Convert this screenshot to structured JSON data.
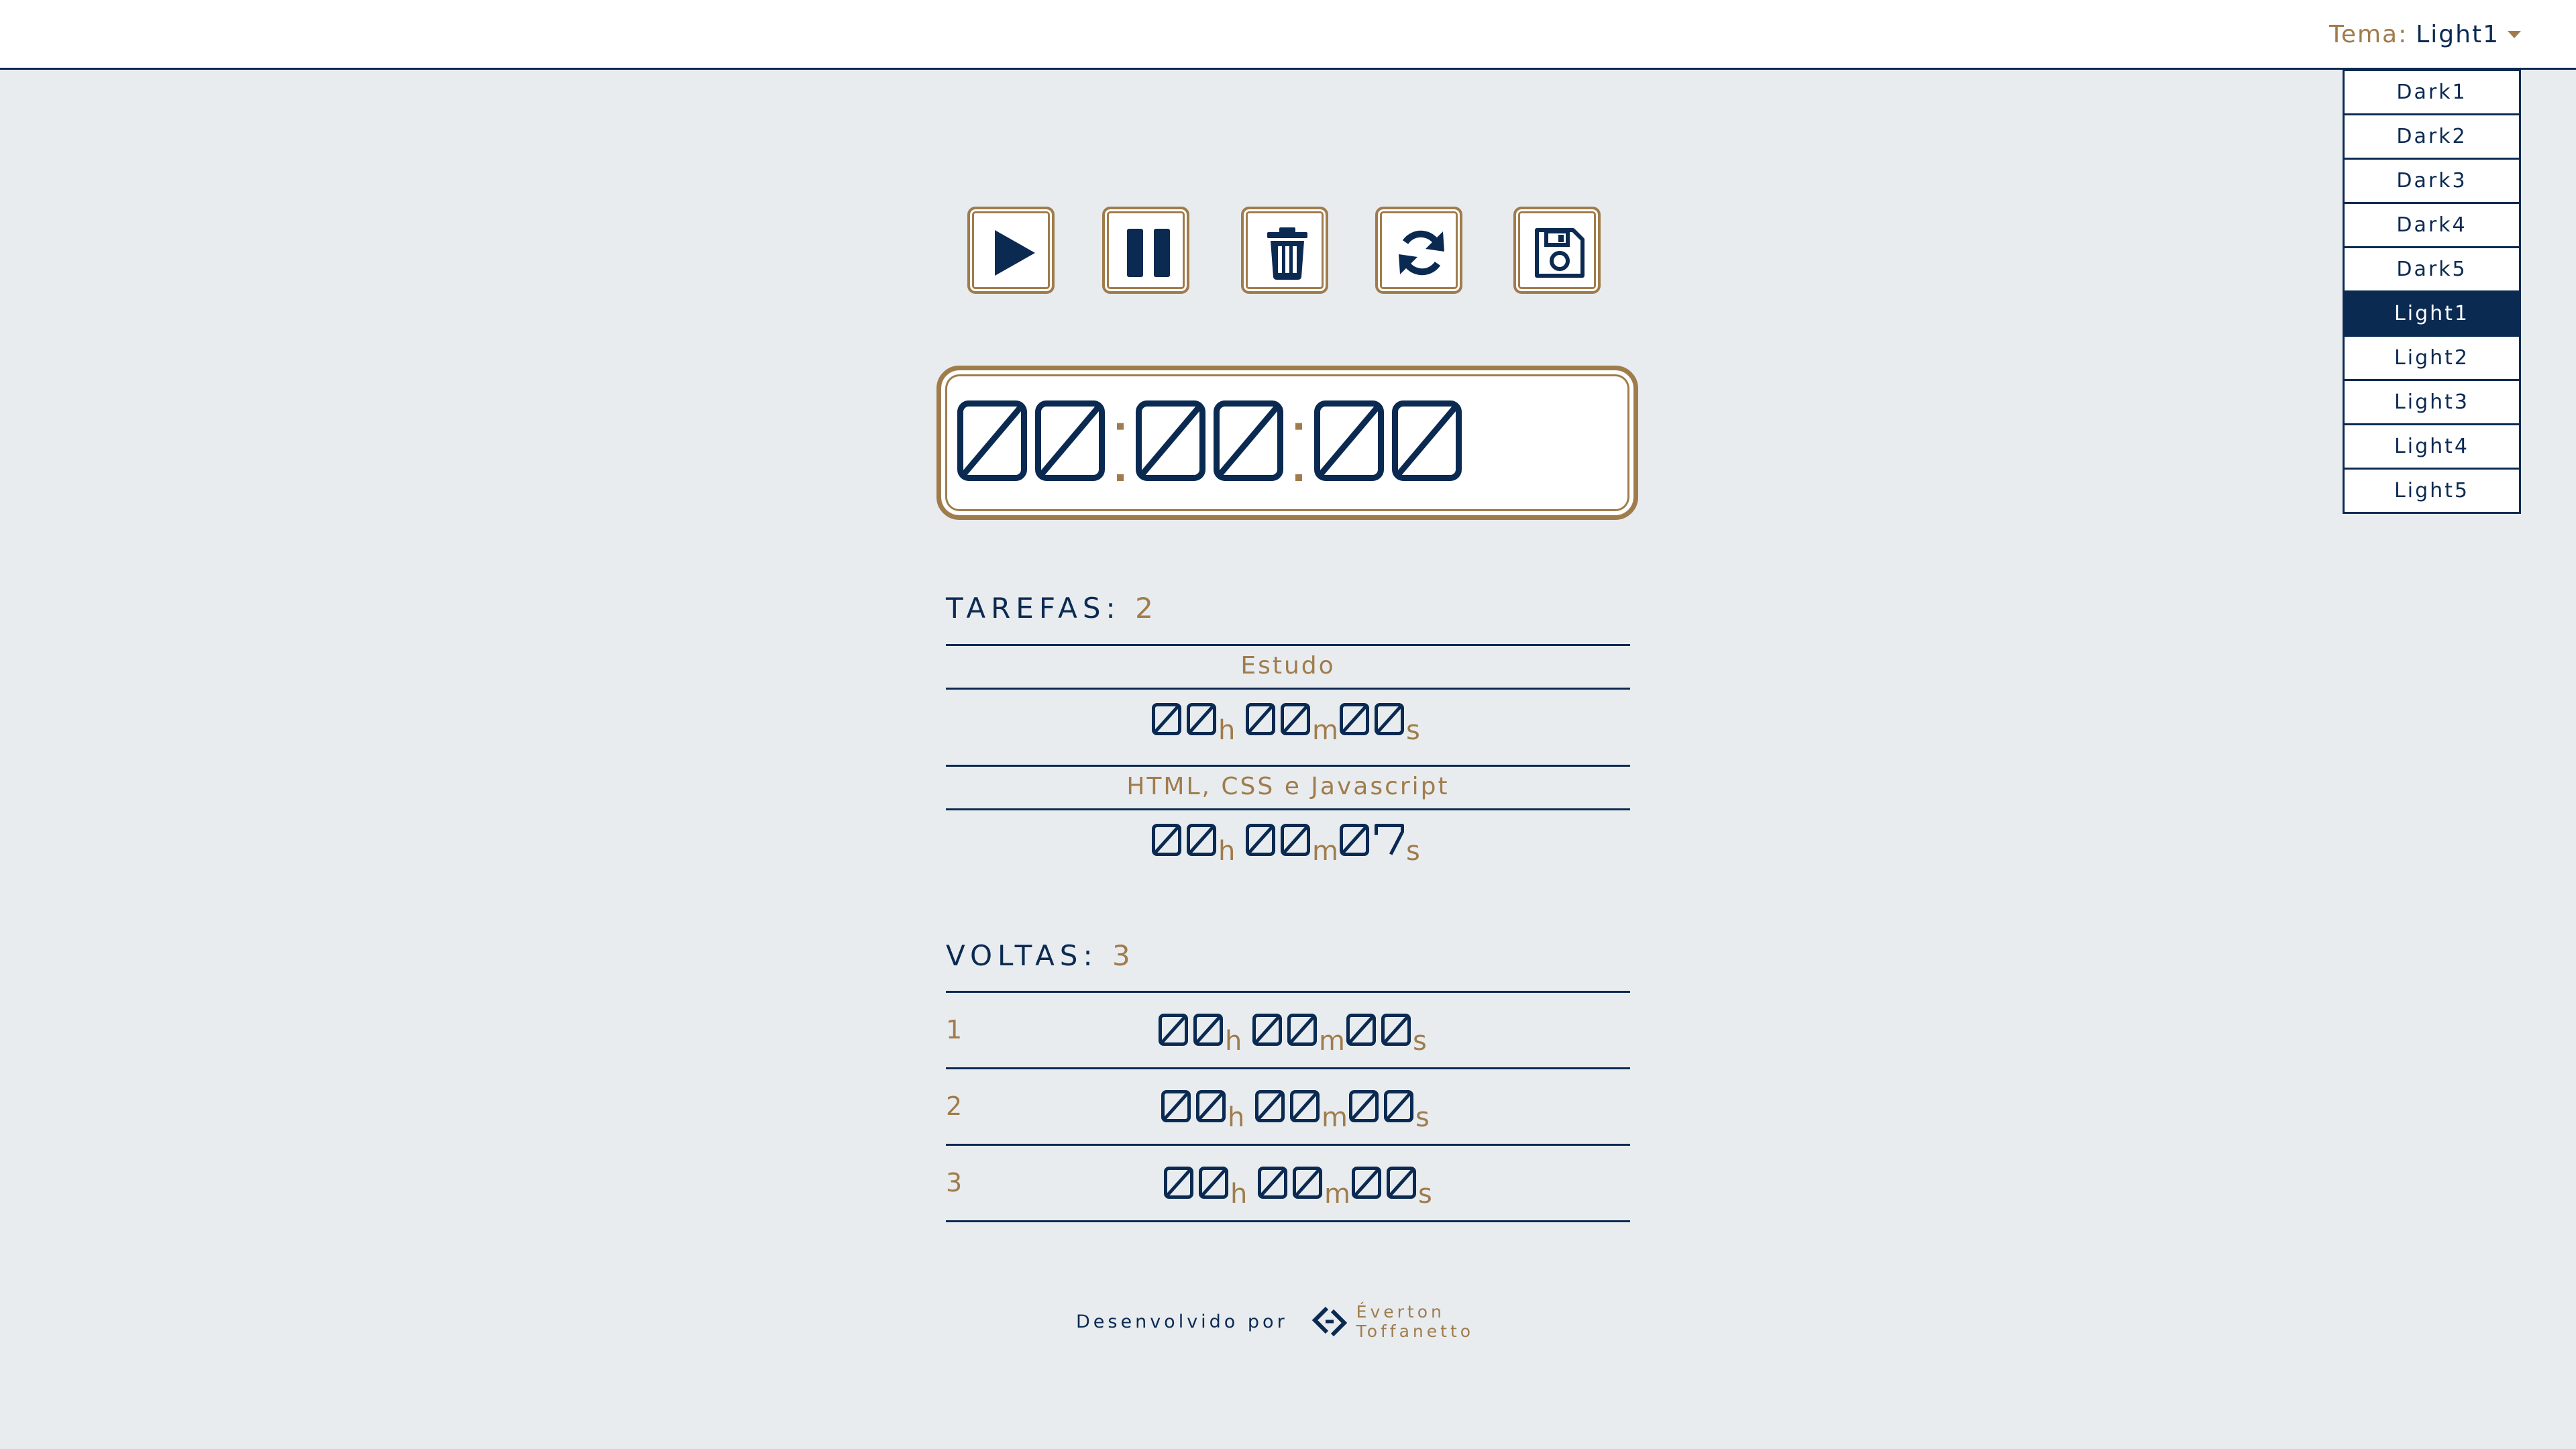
{
  "header": {
    "theme_label": "Tema:",
    "theme_value": "Light1",
    "theme_options": [
      "Dark1",
      "Dark2",
      "Dark3",
      "Dark4",
      "Dark5",
      "Light1",
      "Light2",
      "Light3",
      "Light4",
      "Light5"
    ],
    "active_theme": "Light1"
  },
  "controls": {
    "icons": [
      "play-icon",
      "pause-icon",
      "trash-icon",
      "sync-icon",
      "save-icon"
    ]
  },
  "clock": {
    "hours": "00",
    "minutes": "00",
    "seconds": "00"
  },
  "tasks": {
    "title": "TAREFAS:",
    "count": "2",
    "items": [
      {
        "name": "Estudo",
        "h": "00",
        "m": "00",
        "s": "00"
      },
      {
        "name": "HTML, CSS e Javascript",
        "h": "00",
        "m": "00",
        "s": "07"
      }
    ]
  },
  "laps": {
    "title": "VOLTAS:",
    "count": "3",
    "items": [
      {
        "num": "1",
        "h": "00",
        "m": "00",
        "s": "00"
      },
      {
        "num": "2",
        "h": "00",
        "m": "00",
        "s": "00"
      },
      {
        "num": "3",
        "h": "00",
        "m": "00",
        "s": "00"
      }
    ]
  },
  "units": {
    "h": "h",
    "m": "m",
    "s": "s"
  },
  "footer": {
    "developed_by": "Desenvolvido por",
    "author_line1": "Éverton",
    "author_line2": "Toffanetto"
  },
  "colors": {
    "navy": "#0b2a52",
    "gold": "#a07c4c",
    "background": "#e8ecef"
  }
}
